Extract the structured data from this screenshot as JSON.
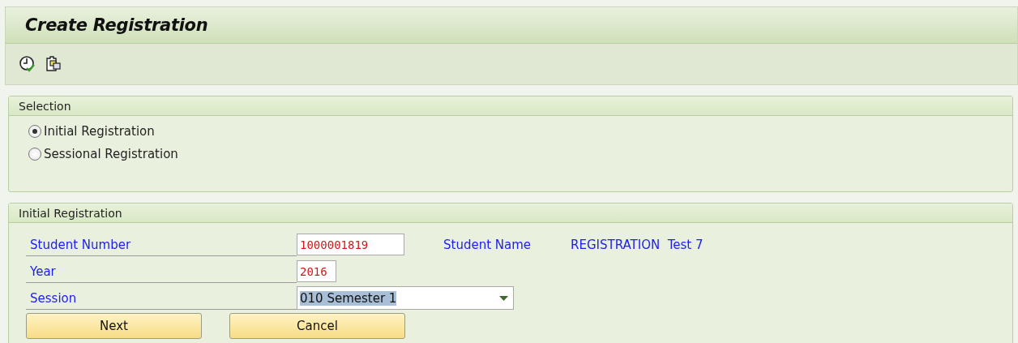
{
  "window": {
    "title": "Create Registration"
  },
  "toolbar": [
    {
      "kind": "clock-check"
    },
    {
      "kind": "copy"
    }
  ],
  "selection": {
    "title": "Selection",
    "options": [
      {
        "label": "Initial Registration",
        "selected": true
      },
      {
        "label": "Sessional Registration",
        "selected": false
      }
    ]
  },
  "initial_registration": {
    "title": "Initial Registration",
    "student_number": {
      "label": "Student Number",
      "value": "1000001819"
    },
    "student_name": {
      "label": "Student Name",
      "value": "REGISTRATION  Test 7"
    },
    "year": {
      "label": "Year",
      "value": "2016"
    },
    "session": {
      "label": "Session",
      "value": "010 Semester 1",
      "text_selected": true
    },
    "buttons": [
      "Next",
      "Cancel"
    ]
  }
}
